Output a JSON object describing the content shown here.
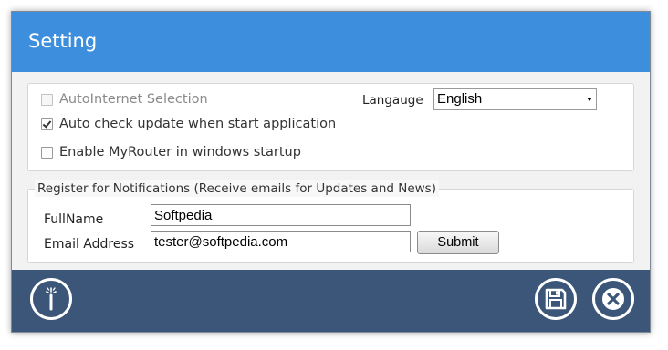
{
  "window": {
    "title": "Setting"
  },
  "options": {
    "auto_internet": {
      "label": "AutoInternet Selection",
      "checked": false,
      "enabled": false
    },
    "auto_check": {
      "label": "Auto check update when start application",
      "checked": true,
      "enabled": true
    },
    "myrouter_startup": {
      "label": "Enable MyRouter in windows startup",
      "checked": false,
      "enabled": true
    },
    "language": {
      "label": "Langauge",
      "selected": "English"
    }
  },
  "register": {
    "legend": "Register for Notifications (Receive emails for Updates and News)",
    "fullname_label": "FullName",
    "fullname_value": "Softpedia",
    "email_label": "Email Address",
    "email_value": "tester@softpedia.com",
    "submit_label": "Submit"
  },
  "footer": {
    "buttons": [
      {
        "name": "magic-wand-icon"
      },
      {
        "name": "save-disk-icon"
      },
      {
        "name": "close-x-icon"
      }
    ]
  },
  "colors": {
    "title_bar": "#3d8fdd",
    "footer_bar": "#3b5678",
    "content_bg": "#f2f2f2"
  }
}
